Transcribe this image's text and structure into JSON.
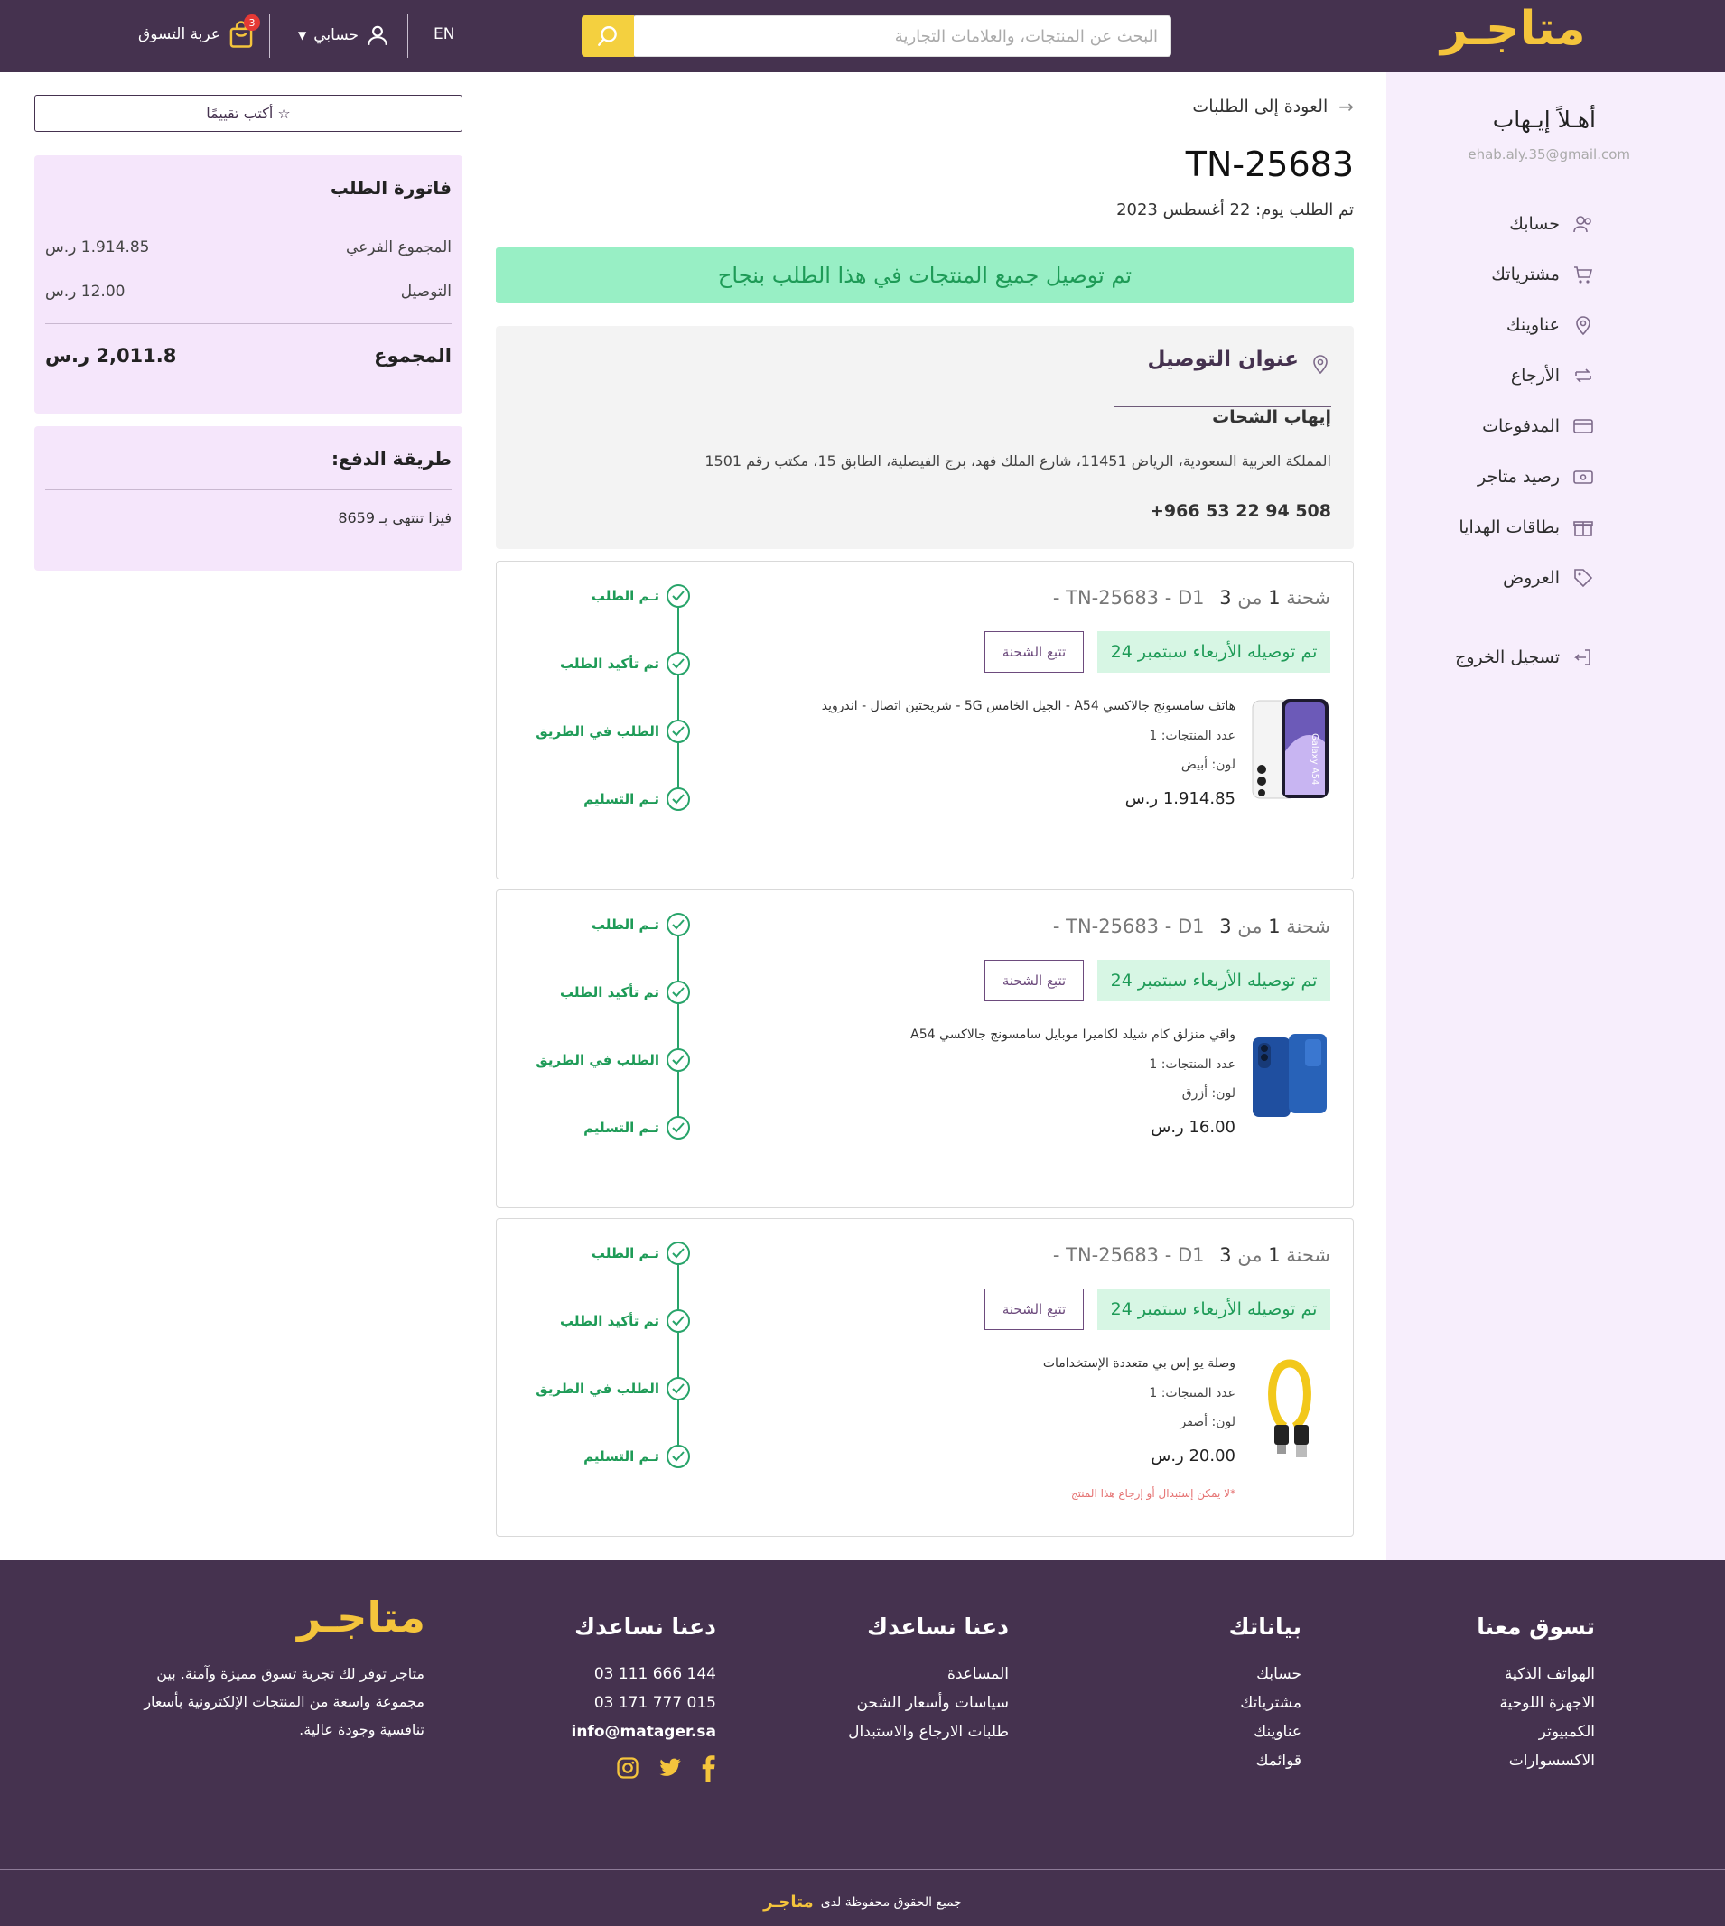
{
  "header": {
    "logo": "متاجـر",
    "search_placeholder": "البحث عن المنتجات، والعلامات التجارية",
    "lang": "EN",
    "account_label": "حسابي",
    "cart_label": "عربة التسوق",
    "cart_count": "3"
  },
  "sidebar": {
    "greeting": "أهـلاً إيـهاب",
    "email": "ehab.aly.35@gmail.com",
    "items": [
      {
        "label": "حسابك",
        "icon": "users-icon"
      },
      {
        "label": "مشترياتك",
        "icon": "cart-icon"
      },
      {
        "label": "عناوينك",
        "icon": "location-icon"
      },
      {
        "label": "الأرجاع",
        "icon": "return-icon"
      },
      {
        "label": "المدفوعات",
        "icon": "card-icon"
      },
      {
        "label": "رصيد متاجر",
        "icon": "wallet-icon"
      },
      {
        "label": "بطاقات الهدايا",
        "icon": "gift-icon"
      },
      {
        "label": "العروض",
        "icon": "tag-icon"
      }
    ],
    "logout": "تسجيل الخروج"
  },
  "order": {
    "back_link": "العودة إلى الطلبات",
    "number": "TN-25683",
    "date": "تم الطلب يوم: 22 أغسطس 2023",
    "delivered_banner": "تم توصيل جميع المنتجات في هذا الطلب بنجاح"
  },
  "address": {
    "title": "عنوان التوصيل",
    "name": "إيهاب الشحات",
    "line": "المملكة العربية السعودية، الرياض 11451، شارع الملك فهد، برج الفيصلية، الطابق 15، مكتب رقم 1501",
    "phone": "+966 53 22 94 508"
  },
  "shipments": [
    {
      "title_prefix": "شحنة",
      "num": "1",
      "of": "من",
      "total": "3",
      "code": "TN-25683 - D1 -",
      "status": "تم توصيله الأربعاء سبتمبر 24",
      "track": "تتبع الشحنة",
      "product": "هاتف سامسونج جالاكسي A54 - الجيل الخامس 5G - شريحتين اتصال - اندرويد",
      "qty": "عدد المنتجات: 1",
      "color": "لون: أبيض",
      "price": "1.914.85 ر.س",
      "note": "",
      "image": "phone"
    },
    {
      "title_prefix": "شحنة",
      "num": "1",
      "of": "من",
      "total": "3",
      "code": "TN-25683 - D1 -",
      "status": "تم توصيله الأربعاء سبتمبر 24",
      "track": "تتبع الشحنة",
      "product": "واقي منزلق كام شيلد لكاميرا موبايل سامسونج جالاكسي A54",
      "qty": "عدد المنتجات: 1",
      "color": "لون: أزرق",
      "price": "16.00 ر.س",
      "note": "",
      "image": "case"
    },
    {
      "title_prefix": "شحنة",
      "num": "1",
      "of": "من",
      "total": "3",
      "code": "TN-25683 - D1 -",
      "status": "تم توصيله الأربعاء سبتمبر 24",
      "track": "تتبع الشحنة",
      "product": "وصلة يو إس بي متعددة الإستخدامات",
      "qty": "عدد المنتجات: 1",
      "color": "لون: أصفر",
      "price": "20.00 ر.س",
      "note": "*لا يمكن إستبدال أو إرجاع هذا المنتج",
      "image": "cable"
    }
  ],
  "timeline": [
    "تـم الطلب",
    "تم تأكيد الطلب",
    "الطلب في الطريق",
    "تـم التسليم"
  ],
  "review_button": "أكتب تقييمًا ☆",
  "invoice": {
    "title": "فاتورة الطلب",
    "subtotal_label": "المجموع الفرعي",
    "subtotal_value": "1.914.85 ر.س",
    "shipping_label": "التوصيل",
    "shipping_value": "12.00 ر.س",
    "total_label": "المجموع",
    "total_value": "2,011.8 ر.س"
  },
  "payment": {
    "title": "طريقة الدفع:",
    "method": "فيزا تنتهي بـ 8659"
  },
  "footer": {
    "col1": {
      "title": "تسوق معنا",
      "links": [
        "الهواتف الذكية",
        "الاجهزة اللوحية",
        "الكمبيوتر",
        "الاكسسوارات"
      ]
    },
    "col2": {
      "title": "بياناتك",
      "links": [
        "حسابك",
        "مشترياتك",
        "عناوينك",
        "قوائمك"
      ]
    },
    "col3": {
      "title": "دعنا نساعدك",
      "links": [
        "المساعدة",
        "سياسات وأسعار الشحن",
        "طلبات الارجاع والاستبدال"
      ]
    },
    "col4": {
      "title": "دعنا نساعدك",
      "links": [
        "03 111 666 144",
        "03 171 777 015",
        "info@matager.sa"
      ]
    },
    "logo": "متاجـر",
    "about": [
      "متاجر توفر لك تجربة تسوق مميزة وآمنة. بين",
      "مجموعة واسعة من المنتجات الإلكترونية بأسعار",
      "تنافسية وجودة عالية."
    ],
    "copyright": "جميع الحقوق محفوظة لدى",
    "copyright_brand": "متاجـر"
  },
  "colors": {
    "primary": "#45324f",
    "accent": "#f4c43c",
    "success": "#1e9b57",
    "sidebar_bg": "#f7eefc"
  }
}
